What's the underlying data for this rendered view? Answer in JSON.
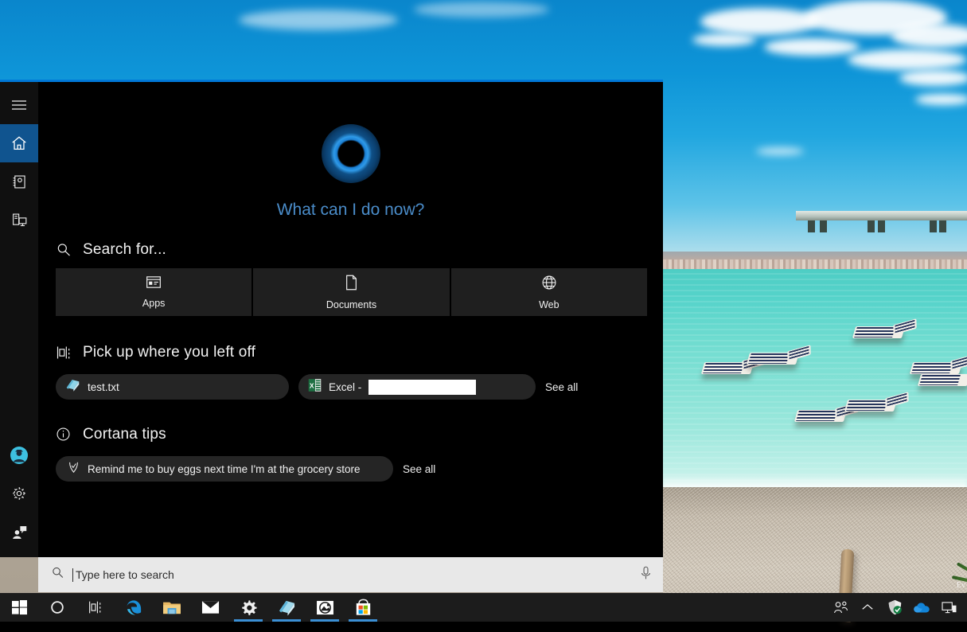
{
  "desktop": {
    "wallpaper_name": "beach-wallpaper",
    "watermark": "Ev"
  },
  "panel": {
    "accent_color": "#0078d7",
    "background_color": "#000000",
    "rail_background_color": "#101010",
    "greeting": "What can I do now?",
    "orb_name": "cortana-orb",
    "rail": [
      {
        "name": "hamburger-menu-icon",
        "label": "Menu",
        "selected": false
      },
      {
        "name": "home-icon",
        "label": "Home",
        "selected": true
      },
      {
        "name": "notebook-icon",
        "label": "Notebook",
        "selected": false
      },
      {
        "name": "devices-icon",
        "label": "Devices",
        "selected": false
      }
    ],
    "rail_bottom": [
      {
        "name": "account-avatar",
        "label": "Account",
        "selected": false
      },
      {
        "name": "gear-icon",
        "label": "Settings",
        "selected": false
      },
      {
        "name": "feedback-icon",
        "label": "Feedback",
        "selected": false
      }
    ],
    "search_for": {
      "title": "Search for...",
      "icon": "search-icon",
      "categories": [
        {
          "label": "Apps",
          "icon": "apps-icon"
        },
        {
          "label": "Documents",
          "icon": "document-icon"
        },
        {
          "label": "Web",
          "icon": "globe-icon"
        }
      ]
    },
    "pick_up": {
      "title": "Pick up where you left off",
      "icon": "timeline-icon",
      "see_all_label": "See all",
      "items": [
        {
          "label": "test.txt",
          "icon": "notepad-file-icon",
          "redacted": false
        },
        {
          "label": "Excel -",
          "icon": "excel-file-icon",
          "redacted": true
        }
      ]
    },
    "cortana_tips": {
      "title": "Cortana tips",
      "icon": "info-icon",
      "see_all_label": "See all",
      "items": [
        {
          "label": "Remind me to buy eggs next time I'm at the grocery store",
          "icon": "reminder-pin-icon"
        }
      ]
    },
    "searchbar": {
      "placeholder": "Type here to search",
      "value": "",
      "search_icon": "search-icon",
      "mic_icon": "microphone-icon"
    }
  },
  "taskbar": {
    "background_color": "#1c1c1c",
    "active_indicator_color": "#3b8fd4",
    "buttons": [
      {
        "name": "start-button",
        "label": "Start",
        "active": false
      },
      {
        "name": "cortana-button",
        "label": "Cortana",
        "active": false
      },
      {
        "name": "task-view-button",
        "label": "Task View",
        "active": false
      },
      {
        "name": "edge-button",
        "label": "Microsoft Edge",
        "active": false
      },
      {
        "name": "file-explorer-button",
        "label": "File Explorer",
        "active": false
      },
      {
        "name": "mail-button",
        "label": "Mail",
        "active": false
      },
      {
        "name": "settings-button",
        "label": "Settings",
        "active": true
      },
      {
        "name": "notepad-button",
        "label": "Notepad",
        "active": true
      },
      {
        "name": "photos-button",
        "label": "Photos",
        "active": true
      },
      {
        "name": "store-button",
        "label": "Microsoft Store",
        "active": true
      }
    ],
    "tray": [
      {
        "name": "people-icon",
        "label": "People"
      },
      {
        "name": "show-hidden-icons-chevron",
        "label": "Show hidden icons"
      },
      {
        "name": "defender-shield-icon",
        "label": "Windows Security"
      },
      {
        "name": "onedrive-cloud-icon",
        "label": "OneDrive"
      },
      {
        "name": "network-icon",
        "label": "Network"
      }
    ]
  }
}
